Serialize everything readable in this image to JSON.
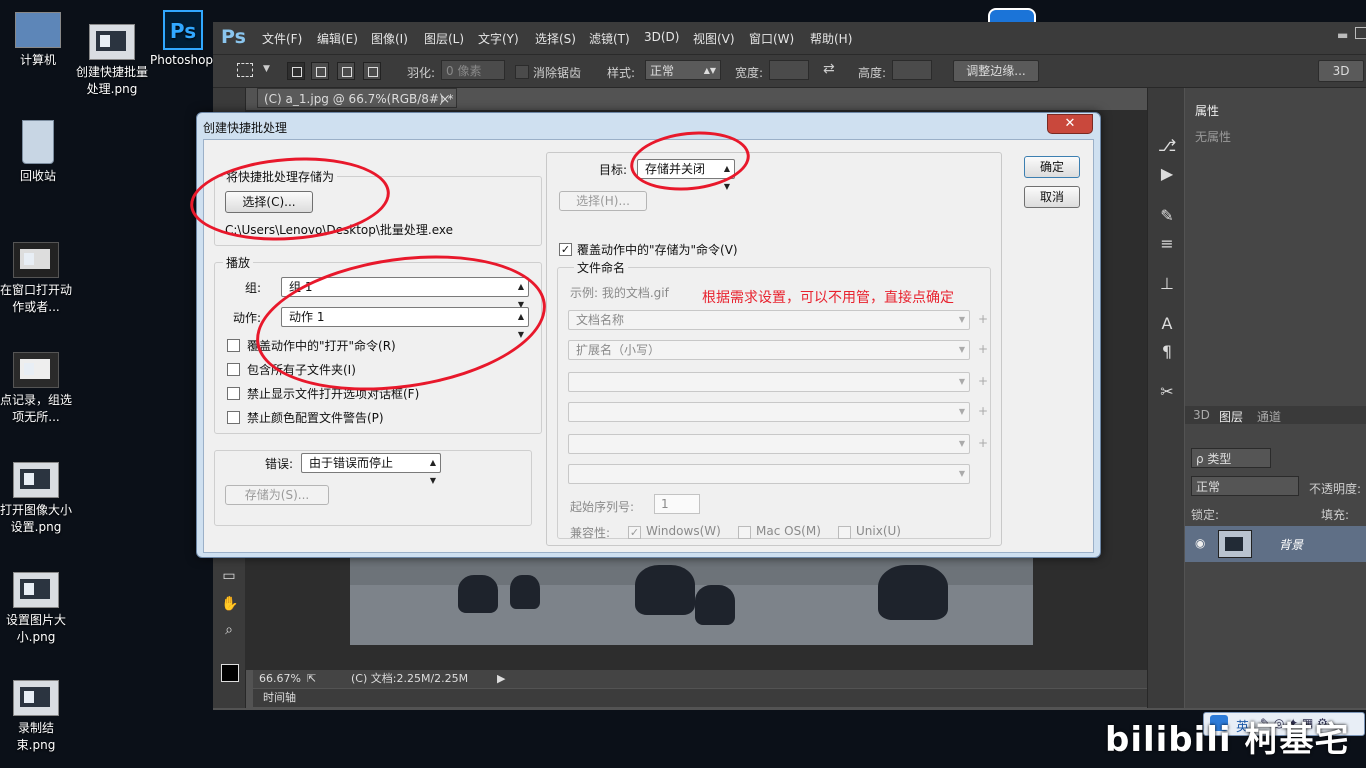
{
  "desktop": {
    "icons": [
      {
        "label": "计算机"
      },
      {
        "label": "创建快捷批量处理.png"
      },
      {
        "label": "Photoshop - 快捷方式"
      },
      {
        "label": "回收站"
      },
      {
        "label": "在窗口打开动作或者..."
      },
      {
        "label": "点记录，组选项无所..."
      },
      {
        "label": "打开图像大小设置.png"
      },
      {
        "label": "设置图片大小.png"
      },
      {
        "label": "录制结束.png"
      }
    ]
  },
  "photoshop": {
    "logo": "Ps",
    "menu": [
      "文件(F)",
      "编辑(E)",
      "图像(I)",
      "图层(L)",
      "文字(Y)",
      "选择(S)",
      "滤镜(T)",
      "3D(D)",
      "视图(V)",
      "窗口(W)",
      "帮助(H)"
    ],
    "options": {
      "feather_label": "羽化:",
      "feather_value": "0 像素",
      "antialias_label": "消除锯齿",
      "style_label": "样式:",
      "style_value": "正常",
      "width_label": "宽度:",
      "height_label": "高度:",
      "refine_edge": "调整边缘...",
      "workspace": "3D"
    },
    "doc_tab": "(C) a_1.jpg @ 66.7%(RGB/8#) *",
    "status": {
      "zoom": "66.67%",
      "doc_info": "(C) 文档:2.25M/2.25M"
    },
    "timeline": "时间轴",
    "properties": {
      "tab": "属性",
      "empty": "无属性"
    },
    "layers": {
      "tabs": [
        "3D",
        "图层",
        "通道"
      ],
      "filter": "ρ 类型",
      "blend_mode": "正常",
      "opacity_label": "不透明度:",
      "lock_label": "锁定:",
      "fill_label": "填充:",
      "layer_name": "背景"
    }
  },
  "dialog": {
    "title": "创建快捷批处理",
    "close": "✕",
    "save_location_group": "将快捷批处理存储为",
    "choose_button": "选择(C)...",
    "save_path": "C:\\Users\\Lenovo\\Desktop\\批量处理.exe",
    "play_group": "播放",
    "set_label": "组:",
    "set_value": "组 1",
    "action_label": "动作:",
    "action_value": "动作 1",
    "checkboxes": [
      "覆盖动作中的\"打开\"命令(R)",
      "包含所有子文件夹(I)",
      "禁止显示文件打开选项对话框(F)",
      "禁止颜色配置文件警告(P)"
    ],
    "errors_label": "错误:",
    "errors_value": "由于错误而停止",
    "errors_save_button": "存储为(S)...",
    "destination_label": "目标:",
    "destination_value": "存储并关闭",
    "dest_choose_button": "选择(H)...",
    "override_save_as": "覆盖动作中的\"存储为\"命令(V)",
    "file_naming_group": "文件命名",
    "example": "示例: 我的文档.gif",
    "naming_fields": [
      "文档名称",
      "扩展名（小写）",
      "",
      "",
      "",
      ""
    ],
    "plus": "+",
    "start_serial_label": "起始序列号:",
    "start_serial_value": "1",
    "compat_label": "兼容性:",
    "compat": [
      "Windows(W)",
      "Mac OS(M)",
      "Unix(U)"
    ],
    "ok_button": "确定",
    "cancel_button": "取消"
  },
  "annotation": "根据需求设置，可以不用管，直接点确定",
  "watermark": "bilibili 柯基宅",
  "tray": {
    "ime": "英"
  },
  "colors": {
    "annotation_red": "#e8182b",
    "ps_accent": "#8ac5ee"
  }
}
